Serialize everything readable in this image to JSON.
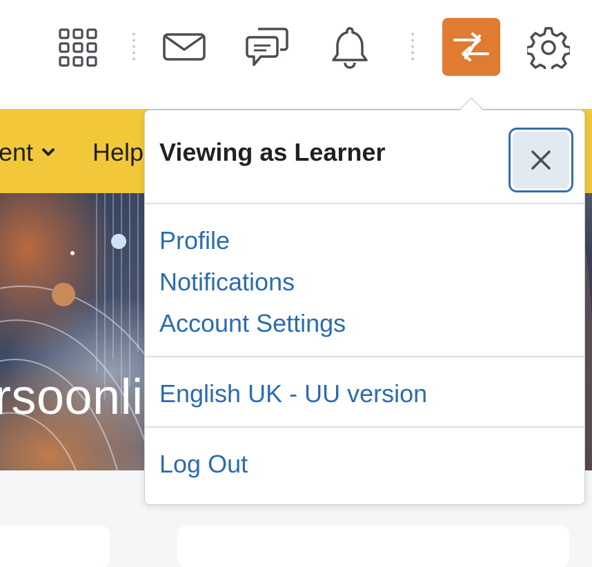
{
  "topbar": {
    "icons": {
      "apps": "grid-icon",
      "messages": "envelope-icon",
      "chat": "chat-icon",
      "alerts": "bell-icon",
      "role_switch": "switch-arrows-icon",
      "settings": "gear-icon"
    },
    "role_switch_color": "#e07b32"
  },
  "navbar": {
    "items": [
      {
        "label": "ent"
      },
      {
        "label": "Help"
      }
    ]
  },
  "banner": {
    "text": "rsoonli"
  },
  "popover": {
    "title": "Viewing as Learner",
    "close_icon": "close-icon",
    "sections": [
      [
        "Profile",
        "Notifications",
        "Account Settings"
      ],
      [
        "English UK - UU version"
      ],
      [
        "Log Out"
      ]
    ]
  },
  "colors": {
    "navbar": "#f2c83a",
    "link": "#2a6bb0",
    "focus_ring": "#2f6db5"
  }
}
